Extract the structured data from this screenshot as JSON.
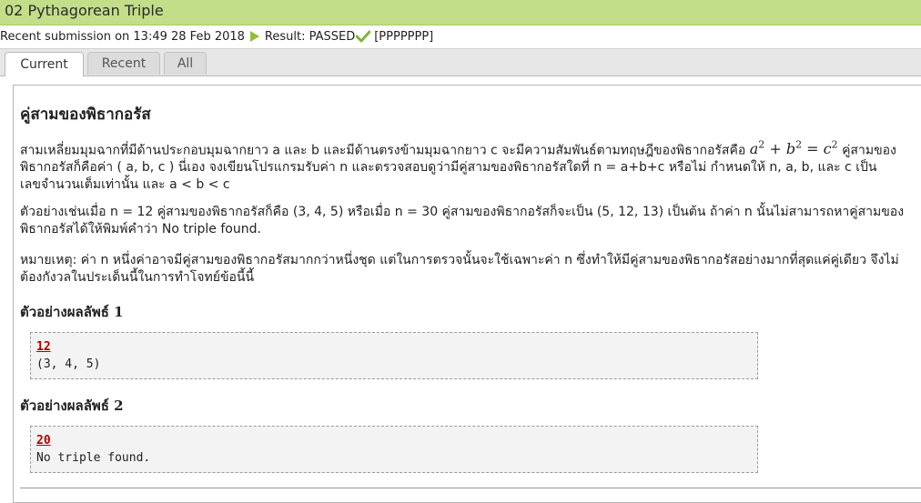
{
  "header": {
    "title": "02 Pythagorean Triple"
  },
  "submission": {
    "prefix": "Recent submission on 13:49 28 Feb 2018",
    "result": "Result: PASSED",
    "detail": "[PPPPPPP]"
  },
  "tabs": [
    {
      "label": "Current"
    },
    {
      "label": "Recent"
    },
    {
      "label": "All"
    }
  ],
  "problem": {
    "title": "คู่สามของพิธากอรัส",
    "paragraph1_text": "สามเหลี่ยมมุมฉากที่มีด้านประกอบมุมฉากยาว a และ b และมีด้านตรงข้ามมุมฉากยาว c จะมีความสัมพันธ์ตามทฤษฎีของพิธากอรัสคือ",
    "paragraph1_rest": "คู่สามของพิธากอรัสก็คือค่า ( a, b, c ) นี่เอง จงเขียนโปรแกรมรับค่า n และตรวจสอบดูว่ามีคู่สามของพิธากอรัสใดที่ n = a+b+c หรือไม่ กำหนดให้ n, a, b, และ c เป็นเลขจำนวนเต็มเท่านั้น และ a < b < c",
    "paragraph2": "ตัวอย่างเช่นเมื่อ n = 12 คู่สามของพิธากอรัสก็คือ (3, 4, 5) หรือเมื่อ n = 30 คู่สามของพิธากอรัสก็จะเป็น (5, 12, 13) เป็นต้น ถ้าค่า n นั้นไม่สามารถหาคู่สามของพิธากอรัสได้ให้พิมพ์คำว่า No triple found.",
    "paragraph3": "หมายเหตุ: ค่า n หนึ่งค่าอาจมีคู่สามของพิธากอรัสมากกว่าหนึ่งชุด แต่ในการตรวจนั้นจะใช้เฉพาะค่า n ซึ่งทำให้มีคู่สามของพิธากอรัสอย่างมากที่สุดแค่คู่เดียว จึงไม่ต้องกังวลในประเด็นนี้ในการทำโจทย์ข้อนี้นี้"
  },
  "samples": [
    {
      "heading": "ตัวอย่างผลลัพธ์ 1",
      "input": "12",
      "output": "(3, 4, 5)"
    },
    {
      "heading": "ตัวอย่างผลลัพธ์ 2",
      "input": "20",
      "output": "No triple found."
    }
  ],
  "colors": {
    "title_bar": "#c3de88",
    "accent_pass": "#8fbf3a",
    "input_red": "#b00000"
  },
  "icons": [
    "play-icon",
    "check-icon"
  ]
}
